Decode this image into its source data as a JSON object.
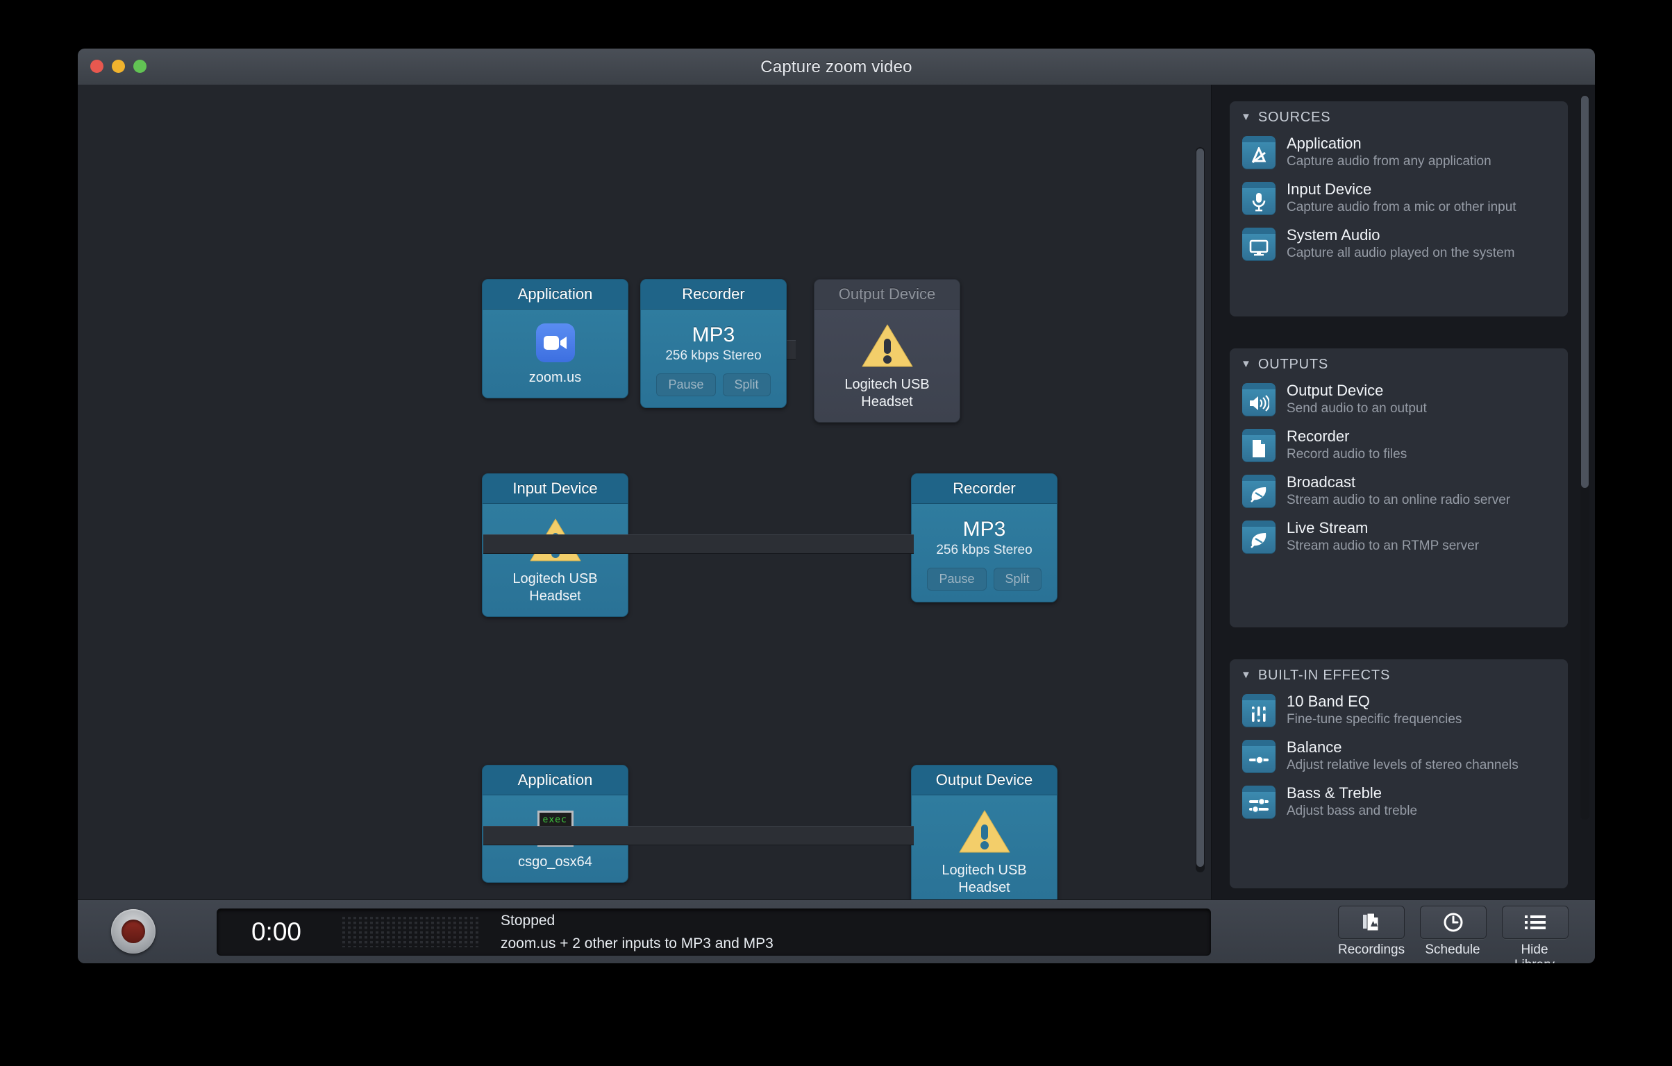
{
  "window": {
    "title": "Capture zoom video",
    "traffic": {
      "close": "close-button",
      "minimize": "minimize-button",
      "zoom": "zoom-button"
    }
  },
  "canvas": {
    "chains": [
      {
        "nodes": [
          {
            "type": "Application",
            "icon": "zoom-app-icon",
            "label": "zoom.us",
            "disabled": false
          },
          {
            "type": "Recorder",
            "format": "MP3",
            "bitrate": "256 kbps Stereo",
            "pause": "Pause",
            "split": "Split",
            "disabled": false
          },
          {
            "type": "Output Device",
            "icon": "warning-icon",
            "label": "Logitech USB Headset",
            "disabled": true
          }
        ]
      },
      {
        "nodes": [
          {
            "type": "Input Device",
            "icon": "warning-icon",
            "label": "Logitech USB Headset",
            "disabled": false
          },
          {
            "type": "Recorder",
            "format": "MP3",
            "bitrate": "256 kbps Stereo",
            "pause": "Pause",
            "split": "Split",
            "disabled": false
          }
        ]
      },
      {
        "nodes": [
          {
            "type": "Application",
            "icon": "exec-icon",
            "icon_text": "exec",
            "label": "csgo_osx64",
            "disabled": false
          },
          {
            "type": "Output Device",
            "icon": "warning-icon",
            "label": "Logitech USB Headset",
            "disabled": false
          }
        ]
      }
    ]
  },
  "library": {
    "sections": [
      {
        "title": "SOURCES",
        "items": [
          {
            "icon": "application-icon",
            "title": "Application",
            "desc": "Capture audio from any application"
          },
          {
            "icon": "microphone-icon",
            "title": "Input Device",
            "desc": "Capture audio from a mic or other input"
          },
          {
            "icon": "display-icon",
            "title": "System Audio",
            "desc": "Capture all audio played on the system"
          }
        ]
      },
      {
        "title": "OUTPUTS",
        "items": [
          {
            "icon": "speaker-icon",
            "title": "Output Device",
            "desc": "Send audio to an output"
          },
          {
            "icon": "document-icon",
            "title": "Recorder",
            "desc": "Record audio to files"
          },
          {
            "icon": "satellite-dish-icon",
            "title": "Broadcast",
            "desc": "Stream audio to an online radio server"
          },
          {
            "icon": "satellite-dish-icon",
            "title": "Live Stream",
            "desc": "Stream audio to an RTMP server"
          }
        ]
      },
      {
        "title": "BUILT-IN EFFECTS",
        "items": [
          {
            "icon": "equalizer-icon",
            "title": "10 Band EQ",
            "desc": "Fine-tune specific frequencies"
          },
          {
            "icon": "balance-slider-icon",
            "title": "Balance",
            "desc": "Adjust relative levels of stereo channels"
          },
          {
            "icon": "bass-treble-icon",
            "title": "Bass & Treble",
            "desc": "Adjust bass and treble"
          }
        ]
      }
    ]
  },
  "bottom": {
    "record": "record-button",
    "timer": "0:00",
    "status": "Stopped",
    "routing": "zoom.us + 2 other inputs to MP3 and MP3",
    "buttons": [
      {
        "icon": "recordings-icon",
        "label": "Recordings"
      },
      {
        "icon": "clock-icon",
        "label": "Schedule"
      },
      {
        "icon": "list-icon",
        "label": "Hide Library"
      }
    ]
  },
  "colors": {
    "node_blue": "#2a7296",
    "node_header": "#1f6488",
    "warning_yellow": "#f3ce6a",
    "accent_record": "#8e2a21"
  }
}
